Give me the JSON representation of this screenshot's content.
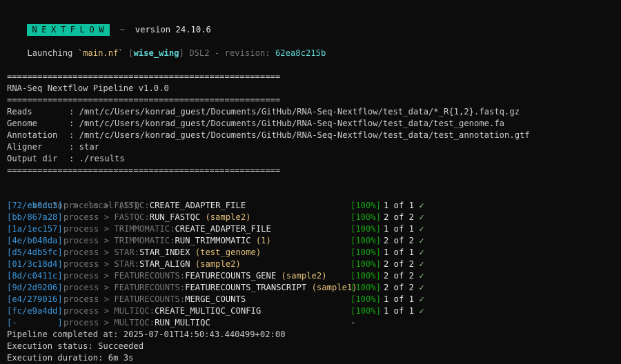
{
  "header": {
    "logo": "NEXTFLOW",
    "tilde": "~",
    "version": "version 24.10.6"
  },
  "launch": {
    "prefix": "Launching ",
    "script": "`main.nf`",
    "run_name_open": " [",
    "run_name": "wise_wing",
    "run_name_close": "]",
    "dsl": " DSL2 - ",
    "revision_label": "revision: ",
    "revision": "62ea8c215b"
  },
  "banner": {
    "separator": "======================================================",
    "title": "RNA-Seq Nextflow Pipeline v1.0.0"
  },
  "params": [
    {
      "label": "Reads",
      "value": ": /mnt/c/Users/konrad_guest/Documents/GitHub/RNA-Seq-Nextflow/test_data/*_R{1,2}.fastq.gz"
    },
    {
      "label": "Genome",
      "value": ": /mnt/c/Users/konrad_guest/Documents/GitHub/RNA-Seq-Nextflow/test_data/test_genome.fa"
    },
    {
      "label": "Annotation",
      "value": ": /mnt/c/Users/konrad_guest/Documents/GitHub/RNA-Seq-Nextflow/test_data/test_annotation.gtf"
    },
    {
      "label": "Aligner",
      "value": ": star"
    },
    {
      "label": "Output dir",
      "value": ": ./results"
    }
  ],
  "executor": {
    "label": "executor >",
    "value": "  local (15)"
  },
  "processes": [
    {
      "hash": "[72/eb0dc3]",
      "module": "FASTQC:",
      "name": "CREATE_ADAPTER_FILE",
      "tag": "",
      "pct": "[100%]",
      "count": "1 of 1",
      "check": "✓"
    },
    {
      "hash": "[bb/867a28]",
      "module": "FASTQC:",
      "name": "RUN_FASTQC",
      "tag": "(sample2)",
      "pct": "[100%]",
      "count": "2 of 2",
      "check": "✓"
    },
    {
      "hash": "[1a/1ec157]",
      "module": "TRIMMOMATIC:",
      "name": "CREATE_ADAPTER_FILE",
      "tag": "",
      "pct": "[100%]",
      "count": "1 of 1",
      "check": "✓"
    },
    {
      "hash": "[4e/b048da]",
      "module": "TRIMMOMATIC:",
      "name": "RUN_TRIMMOMATIC",
      "tag": "(1)",
      "pct": "[100%]",
      "count": "2 of 2",
      "check": "✓"
    },
    {
      "hash": "[d5/4db5fc]",
      "module": "STAR:",
      "name": "STAR_INDEX",
      "tag": "(test_genome)",
      "pct": "[100%]",
      "count": "1 of 1",
      "check": "✓"
    },
    {
      "hash": "[01/3c18d4]",
      "module": "STAR:",
      "name": "STAR_ALIGN",
      "tag": "(sample2)",
      "pct": "[100%]",
      "count": "2 of 2",
      "check": "✓"
    },
    {
      "hash": "[8d/c0411c]",
      "module": "FEATURECOUNTS:",
      "name": "FEATURECOUNTS_GENE",
      "tag": "(sample2)",
      "pct": "[100%]",
      "count": "2 of 2",
      "check": "✓"
    },
    {
      "hash": "[9d/2d9206]",
      "module": "FEATURECOUNTS:",
      "name": "FEATURECOUNTS_TRANSCRIPT",
      "tag": "(sample1)",
      "pct": "[100%]",
      "count": "2 of 2",
      "check": "✓"
    },
    {
      "hash": "[e4/279016]",
      "module": "FEATURECOUNTS:",
      "name": "MERGE_COUNTS",
      "tag": "",
      "pct": "[100%]",
      "count": "1 of 1",
      "check": "✓"
    },
    {
      "hash": "[fc/e9a4dd]",
      "module": "MULTIQC:",
      "name": "CREATE_MULTIQC_CONFIG",
      "tag": "",
      "pct": "[100%]",
      "count": "1 of 1",
      "check": "✓"
    },
    {
      "hash": "[-        ]",
      "module": "MULTIQC:",
      "name": "RUN_MULTIQC",
      "tag": "",
      "pct": "-",
      "count": "",
      "check": ""
    }
  ],
  "process_word": "process > ",
  "footer": {
    "completed": "Pipeline completed at: 2025-07-01T14:50:43.440499+02:00",
    "status": "Execution status: Succeeded",
    "duration": "Execution duration: 6m 3s"
  },
  "colors": {
    "background": "#0c0c0c",
    "logo": "#0dc09d",
    "hash": "#3a96dd",
    "tag": "#e5c07b",
    "check": "#9bd88f"
  }
}
